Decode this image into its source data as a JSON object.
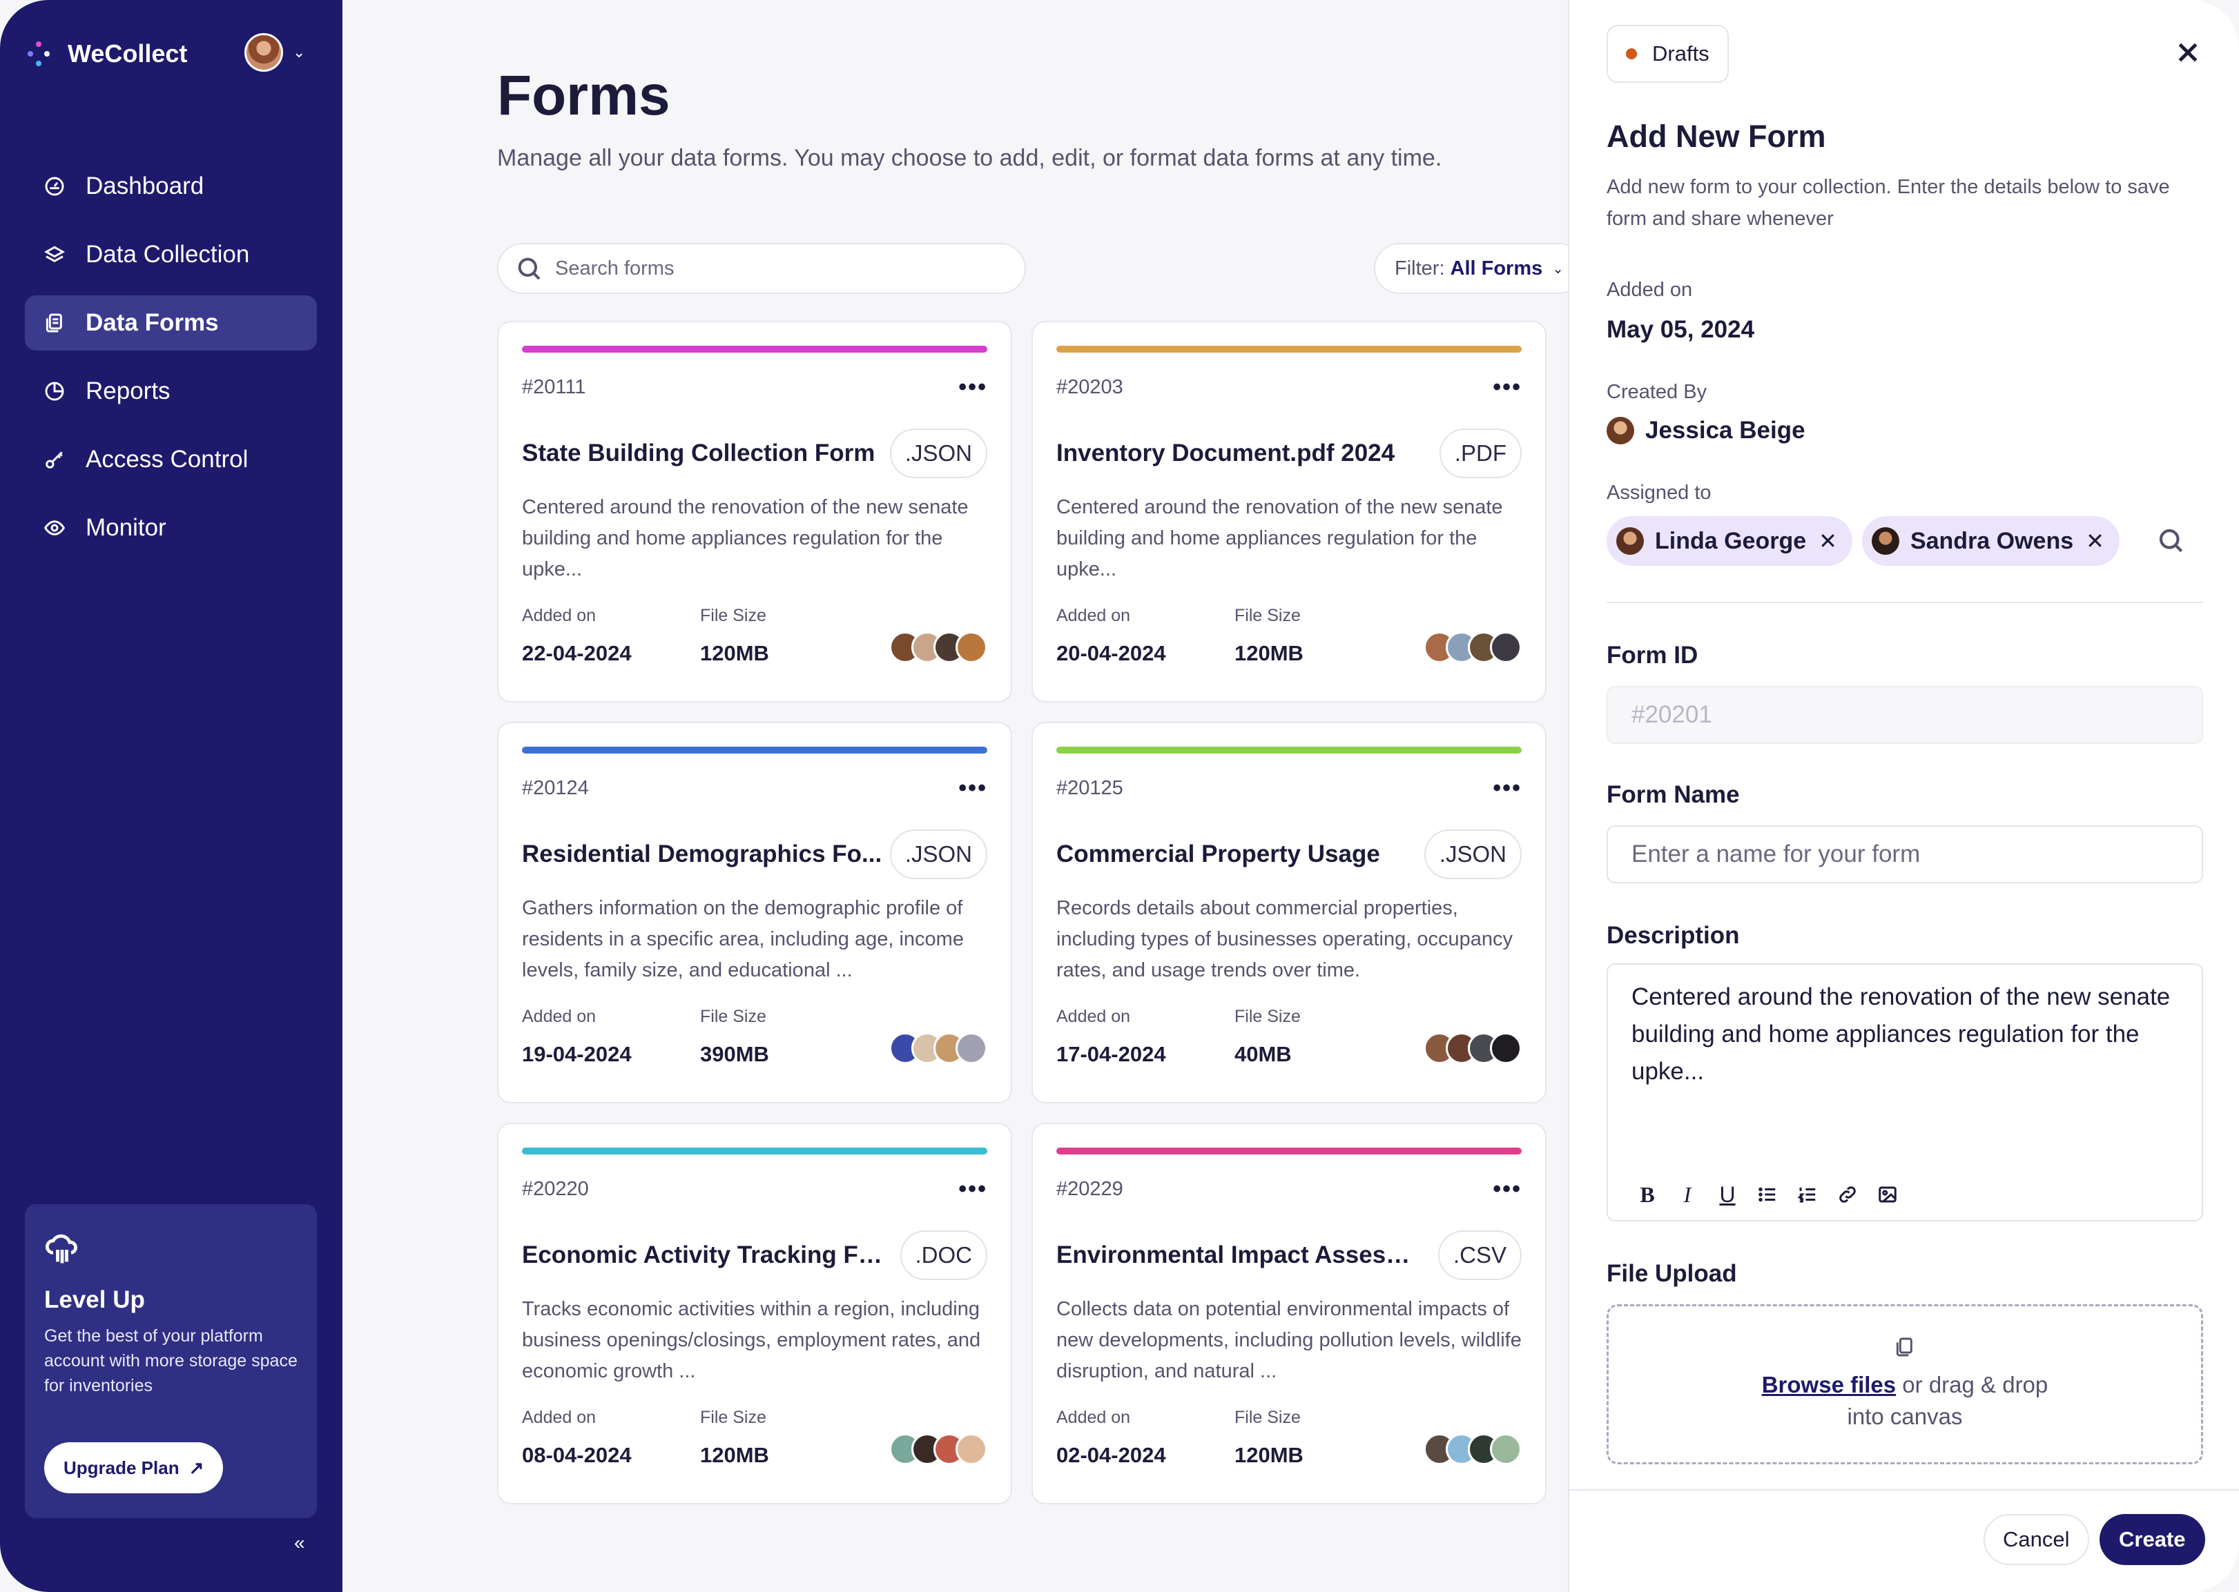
{
  "app": {
    "name": "WeCollect"
  },
  "sidebar": {
    "items": [
      {
        "label": "Dashboard",
        "icon": "dashboard-icon"
      },
      {
        "label": "Data Collection",
        "icon": "layers-icon"
      },
      {
        "label": "Data Forms",
        "icon": "forms-icon",
        "active": true
      },
      {
        "label": "Reports",
        "icon": "pie-chart-icon"
      },
      {
        "label": "Access Control",
        "icon": "key-icon"
      },
      {
        "label": "Monitor",
        "icon": "eye-icon"
      }
    ],
    "levelup": {
      "title": "Level Up",
      "text": "Get the best of your platform account with more storage space for inventories",
      "button": "Upgrade Plan",
      "icon": "cloud-icon"
    },
    "collapse": "«"
  },
  "main": {
    "title": "Forms",
    "subtitle": "Manage all your data forms. You may choose to add, edit, or format data forms at any time.",
    "search_placeholder": "Search forms",
    "filter_label": "Filter:",
    "filter_value": "All Forms",
    "added_label": "Added on",
    "size_label": "File Size",
    "more": "•••",
    "cards": [
      {
        "id": "#20111",
        "title": "State Building Collection Form",
        "ext": ".JSON",
        "color": "#d63fcf",
        "desc": "Centered around the renovation of the new senate building and home appliances regulation for the upke...",
        "added": "22-04-2024",
        "size": "120MB"
      },
      {
        "id": "#20203",
        "title": "Inventory Document.pdf 2024",
        "ext": ".PDF",
        "color": "#dca24a",
        "desc": "Centered around the renovation of the new senate building and home appliances regulation for the upke...",
        "added": "20-04-2024",
        "size": "120MB"
      },
      {
        "id": "#20124",
        "title": "Residential Demographics Fo...",
        "ext": ".JSON",
        "color": "#3f6fd6",
        "desc": "Gathers information on the demographic profile of residents in a specific area, including age, income levels, family size, and educational ...",
        "added": "19-04-2024",
        "size": "390MB"
      },
      {
        "id": "#20125",
        "title": "Commercial Property Usage",
        "ext": ".JSON",
        "color": "#8bd147",
        "desc": "Records details about commercial properties, including types of businesses operating, occupancy rates, and usage trends over time.",
        "added": "17-04-2024",
        "size": "40MB"
      },
      {
        "id": "#20220",
        "title": "Economic Activity Tracking Fo...",
        "ext": ".DOC",
        "color": "#3bbcd0",
        "desc": "Tracks economic activities within a region, including business openings/closings, employment rates, and economic growth ...",
        "added": "08-04-2024",
        "size": "120MB"
      },
      {
        "id": "#20229",
        "title": "Environmental Impact Assessm...",
        "ext": ".CSV",
        "color": "#de3f8c",
        "desc": "Collects data on potential environmental impacts of new developments, including pollution levels, wildlife disruption, and natural ...",
        "added": "02-04-2024",
        "size": "120MB"
      }
    ]
  },
  "drawer": {
    "status": "Drafts",
    "title": "Add New Form",
    "subtitle": "Add new form to your collection. Enter the details below to save form and share whenever",
    "added_label": "Added on",
    "added_value": "May 05, 2024",
    "created_label": "Created By",
    "created_value": "Jessica Beige",
    "assigned_label": "Assigned to",
    "assignees": [
      "Linda George",
      "Sandra Owens"
    ],
    "form_id_label": "Form ID",
    "form_id_value": "#20201",
    "form_name_label": "Form Name",
    "form_name_placeholder": "Enter a name for your form",
    "description_label": "Description",
    "description_value": "Centered around the renovation of the new senate building and home appliances regulation for the upke...",
    "upload_label": "File Upload",
    "upload_link": "Browse files",
    "upload_rest": " or drag & drop into canvas",
    "cancel": "Cancel",
    "create": "Create"
  }
}
